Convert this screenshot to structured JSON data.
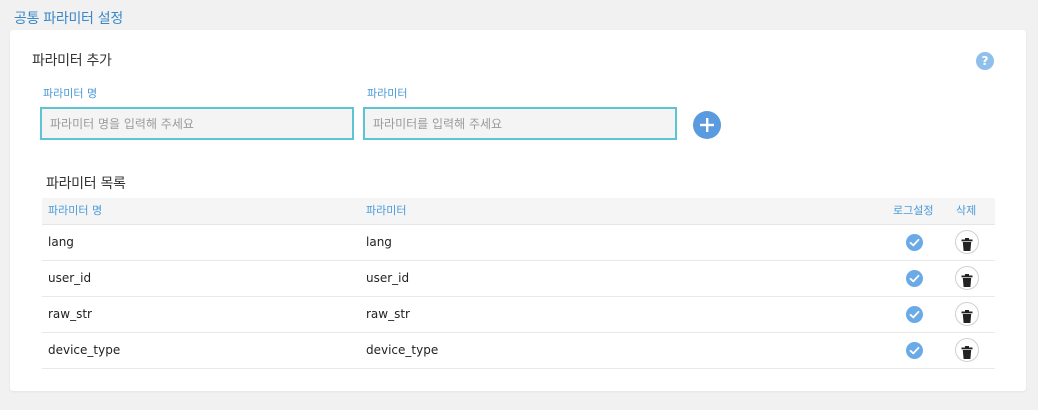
{
  "page": {
    "title": "공통 파라미터 설정"
  },
  "add_section": {
    "title": "파라미터 추가",
    "help_icon_text": "?",
    "name_label": "파라미터 명",
    "name_placeholder": "파라미터 명을 입력해 주세요",
    "param_label": "파라미터",
    "param_placeholder": "파라미터를 입력해 주세요",
    "add_icon": "plus-icon"
  },
  "list_section": {
    "title": "파라미터 목록",
    "columns": {
      "name": "파라미터 명",
      "param": "파라미터",
      "log": "로그설정",
      "delete": "삭제"
    },
    "rows": [
      {
        "name": "lang",
        "param": "lang",
        "log_enabled": true
      },
      {
        "name": "user_id",
        "param": "user_id",
        "log_enabled": true
      },
      {
        "name": "raw_str",
        "param": "raw_str",
        "log_enabled": true
      },
      {
        "name": "device_type",
        "param": "device_type",
        "log_enabled": true
      }
    ]
  },
  "colors": {
    "accent": "#3a87c8",
    "input_border": "#5ec4d4",
    "add_button": "#5a9be0",
    "check": "#6aaae6",
    "help": "#8fc0ec"
  }
}
